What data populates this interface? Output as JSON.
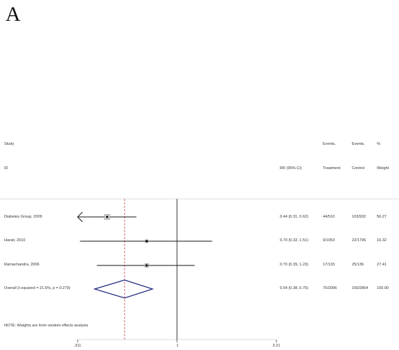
{
  "panel_label": "A",
  "header": {
    "study": "Study",
    "id": "ID",
    "rr": "RR (95% CI)",
    "events_t_1": "Events,",
    "events_t_2": "Treatment",
    "events_c_1": "Events,",
    "events_c_2": "Control",
    "pct": "%",
    "weight": "Weight"
  },
  "note": "NOTE: Weights are from random effects analysis",
  "chart_data": {
    "type": "forest",
    "x_scale": "log",
    "xlim": [
      0.311,
      3.21
    ],
    "x_ticks": [
      ".311",
      "1",
      "3.21"
    ],
    "null_line": 1,
    "overall_line": 0.54,
    "studies": [
      {
        "id": "Diabetes Group, 2009",
        "rr": 0.44,
        "lo": 0.31,
        "hi": 0.62,
        "rr_text": "0.44 (0.31, 0.62)",
        "treatment": "44/510",
        "control": "103/932",
        "weight": "56.27",
        "weight_value": 56.27,
        "arrow_left": true
      },
      {
        "id": "Harati, 2010",
        "rr": 0.7,
        "lo": 0.32,
        "hi": 1.51,
        "rr_text": "0.70 (0.32, 1.51)",
        "treatment": "9/1053",
        "control": "22/1796",
        "weight": "16.32",
        "weight_value": 16.32,
        "arrow_left": false
      },
      {
        "id": "Ramachandra, 2006",
        "rr": 0.7,
        "lo": 0.39,
        "hi": 1.23,
        "rr_text": "0.70 (0.39, 1.23)",
        "treatment": "17/133",
        "control": "25/136",
        "weight": "27.41",
        "weight_value": 27.41,
        "arrow_left": false
      }
    ],
    "overall": {
      "id": "Overall  (I-squared = 21.6%, p = 0.279)",
      "rr": 0.54,
      "lo": 0.38,
      "hi": 0.75,
      "rr_text": "0.54 (0.38, 0.75)",
      "treatment": "70/2096",
      "control": "150/2864",
      "weight": "100.00"
    }
  }
}
